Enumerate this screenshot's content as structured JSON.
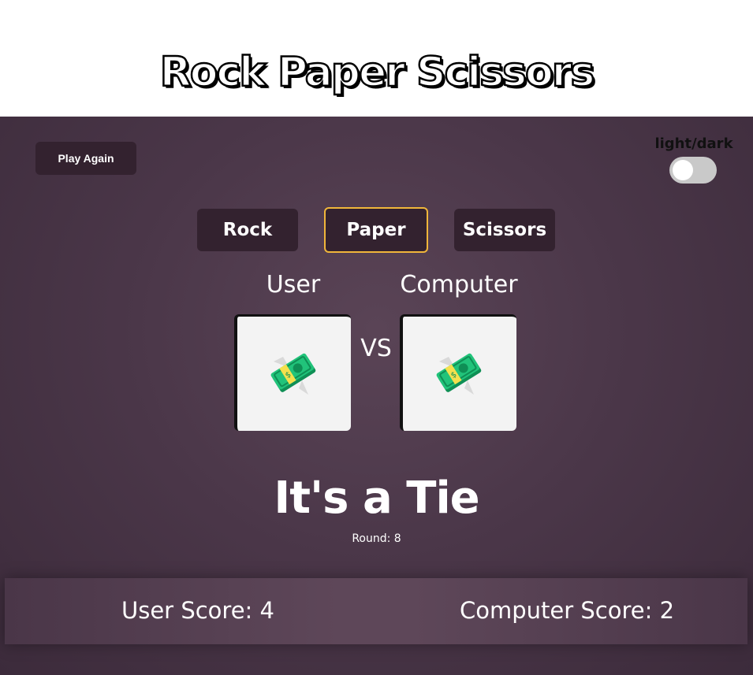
{
  "header": {
    "title": "Rock Paper Scissors"
  },
  "controls": {
    "play_again_label": "Play Again",
    "theme_toggle_label": "light/dark",
    "theme_toggle_on": false
  },
  "choices": [
    {
      "label": "Rock",
      "selected": false
    },
    {
      "label": "Paper",
      "selected": true
    },
    {
      "label": "Scissors",
      "selected": false
    }
  ],
  "arena": {
    "user_label": "User",
    "computer_label": "Computer",
    "vs_label": "VS",
    "user_choice_icon": "money-with-wings-icon",
    "computer_choice_icon": "money-with-wings-icon"
  },
  "result": {
    "text": "It's a Tie",
    "round_text": "Round: 8"
  },
  "scores": {
    "user_text": "User Score: 4",
    "computer_text": "Computer Score: 2"
  },
  "colors": {
    "stage_bg": "#4b3749",
    "button_bg": "#33222f",
    "selected_border": "#f0b63a",
    "card_bg": "#f3f3f3"
  }
}
